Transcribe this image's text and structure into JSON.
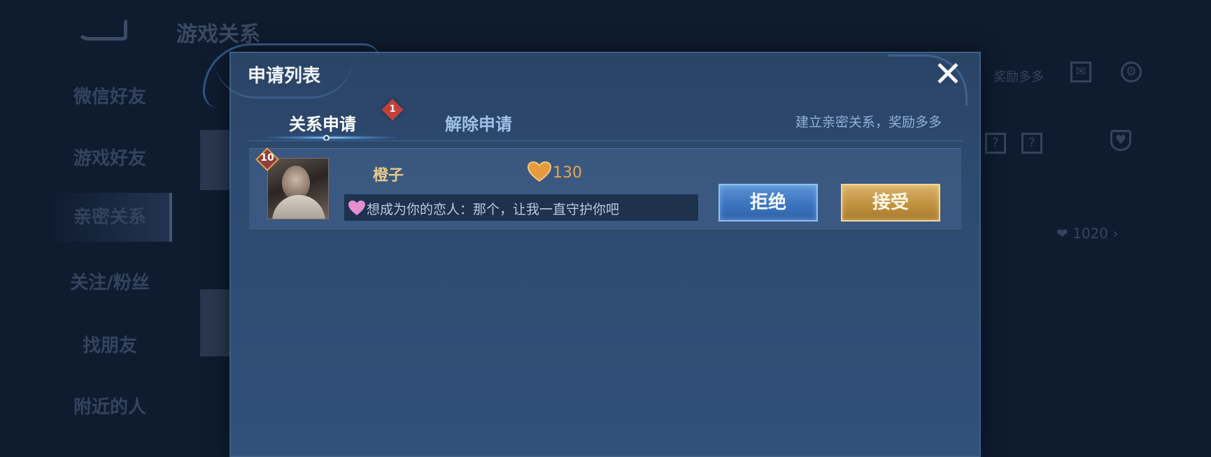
{
  "background": {
    "page_title": "游戏关系",
    "sidebar": [
      {
        "label": "微信好友"
      },
      {
        "label": "游戏好友"
      },
      {
        "label": "亲密关系"
      },
      {
        "label": "关注/粉丝"
      },
      {
        "label": "找朋友"
      },
      {
        "label": "附近的人"
      }
    ],
    "right_hint": "奖励多多",
    "intimacy_total": "1020"
  },
  "modal": {
    "title": "申请列表",
    "close_icon": "close-icon",
    "tabs": [
      {
        "label": "关系申请",
        "active": true,
        "badge": "1"
      },
      {
        "label": "解除申请",
        "active": false
      }
    ],
    "hint": "建立亲密关系，奖励多多",
    "requests": [
      {
        "level": "10",
        "name": "橙子",
        "intimacy": "130",
        "message": "想成为你的恋人：那个，让我一直守护你吧",
        "reject_label": "拒绝",
        "accept_label": "接受"
      }
    ]
  },
  "colors": {
    "accent_gold": "#e8c988",
    "intimacy_orange": "#e6a651",
    "reject_blue": "#3c74bf",
    "accept_gold": "#c0913f",
    "badge_red": "#c2413d"
  }
}
